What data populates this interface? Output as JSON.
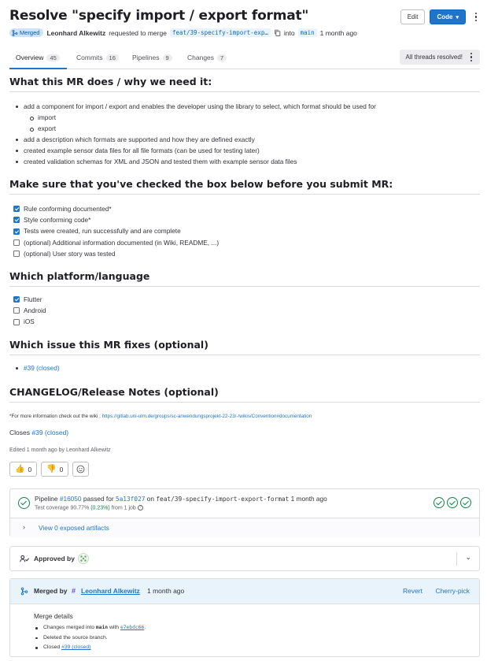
{
  "header": {
    "title": "Resolve \"specify import / export format\"",
    "edit_label": "Edit",
    "code_label": "Code",
    "status_label": "Merged",
    "author": "Leonhard Alkewitz",
    "requested_text": "requested to merge",
    "source_branch": "feat/39-specify-import-exp…",
    "into_text": "into",
    "target_branch": "main",
    "time": "1 month ago"
  },
  "tabs": [
    {
      "label": "Overview",
      "count": "45"
    },
    {
      "label": "Commits",
      "count": "16"
    },
    {
      "label": "Pipelines",
      "count": "9"
    },
    {
      "label": "Changes",
      "count": "7"
    }
  ],
  "threads_label": "All threads resolved!",
  "description": {
    "h_what": "What this MR does / why we need it:",
    "what_items": [
      "add a component for import / export and enables the developer using the library to select, which format should be used for",
      "import",
      "export",
      "add a description which formats are supported and how they are defined exactly",
      "created example sensor data files for all file formats (can be used for testing later)",
      "created validation schemas for XML and JSON and tested them with example sensor data files"
    ],
    "h_check": "Make sure that you've checked the box below before you submit MR:",
    "checks": [
      {
        "label": "Rule conforming documented*",
        "checked": true
      },
      {
        "label": "Style conforming code*",
        "checked": true
      },
      {
        "label": "Tests were created, run successfully and are complete",
        "checked": true
      },
      {
        "label": "(optional) Additional information documented (in Wiki, README, ...)",
        "checked": false
      },
      {
        "label": "(optional) User story was tested",
        "checked": false
      }
    ],
    "h_platform": "Which platform/language",
    "platforms": [
      {
        "label": "Flutter",
        "checked": true
      },
      {
        "label": "Android",
        "checked": false
      },
      {
        "label": "iOS",
        "checked": false
      }
    ],
    "h_issue": "Which issue this MR fixes (optional)",
    "issue_link": "#39 (closed)",
    "h_changelog": "CHANGELOG/Release Notes (optional)",
    "wiki_prefix": "*For more information check out the wiki : ",
    "wiki_url": "https://gitlab.uni-ulm.de/groups/sc-anwendungsprojekt-22-23/-/wikis/Convention#documentation",
    "closes_text": "Closes",
    "closes_link": "#39 (closed)",
    "edited_text": "Edited 1 month ago by Leonhard Alkewitz"
  },
  "reactions": {
    "thumbs_up": "0",
    "thumbs_down": "0"
  },
  "pipeline": {
    "pipeline_word": "Pipeline",
    "id": "#16050",
    "passed_for": "passed for",
    "commit": "5a13f027",
    "on_word": "on",
    "branch": "feat/39-specify-import-export-format",
    "time": "1 month ago",
    "coverage_label": "Test coverage 90.77%",
    "coverage_delta": "(0.23%)",
    "from_job": "from 1 job",
    "artifacts": "View 0 exposed artifacts"
  },
  "approval": {
    "label": "Approved by"
  },
  "merged": {
    "merged_by": "Merged by",
    "user": "Leonhard Alkewitz",
    "time": "1 month ago",
    "revert": "Revert",
    "cherry_pick": "Cherry-pick",
    "details_title": "Merge details",
    "changes_prefix": "Changes merged into",
    "changes_branch": "main",
    "changes_with": "with",
    "changes_commit": "e7ebdc66",
    "deleted": "Deleted the source branch.",
    "closed_prefix": "Closed",
    "closed_link": "#39 (closed)"
  },
  "colors": {
    "accent": "#1f75cb",
    "success": "#108548",
    "merged_badge_bg": "#cbe2f9"
  }
}
